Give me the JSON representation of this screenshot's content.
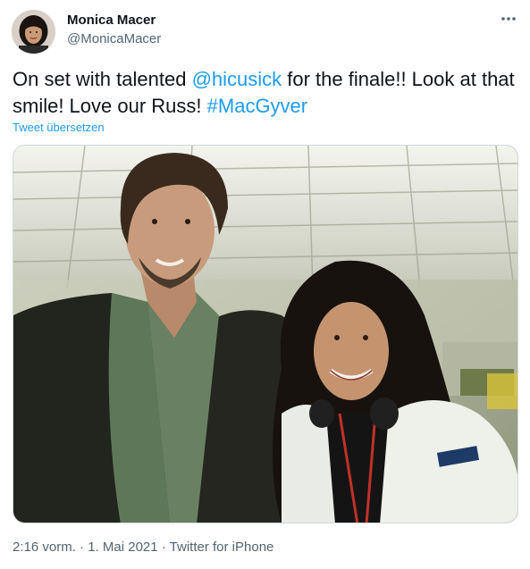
{
  "author": {
    "display_name": "Monica Macer",
    "handle": "@MonicaMacer"
  },
  "more_icon": "more-horizontal-icon",
  "tweet": {
    "text_part1": "On set with talented ",
    "mention": "@hicusick",
    "text_part2": " for the finale!! Look at that smile! Love our Russ! ",
    "hashtag": "#MacGyver",
    "translate_label": "Tweet übersetzen"
  },
  "meta": {
    "time": "2:16 vorm.",
    "separator1": " · ",
    "date": "1. Mai 2021",
    "separator2": " · ",
    "source": "Twitter for iPhone"
  },
  "colors": {
    "link": "#1d9bf0",
    "secondary_text": "#536471",
    "primary_text": "#0f1419",
    "border": "#cfd9de"
  }
}
